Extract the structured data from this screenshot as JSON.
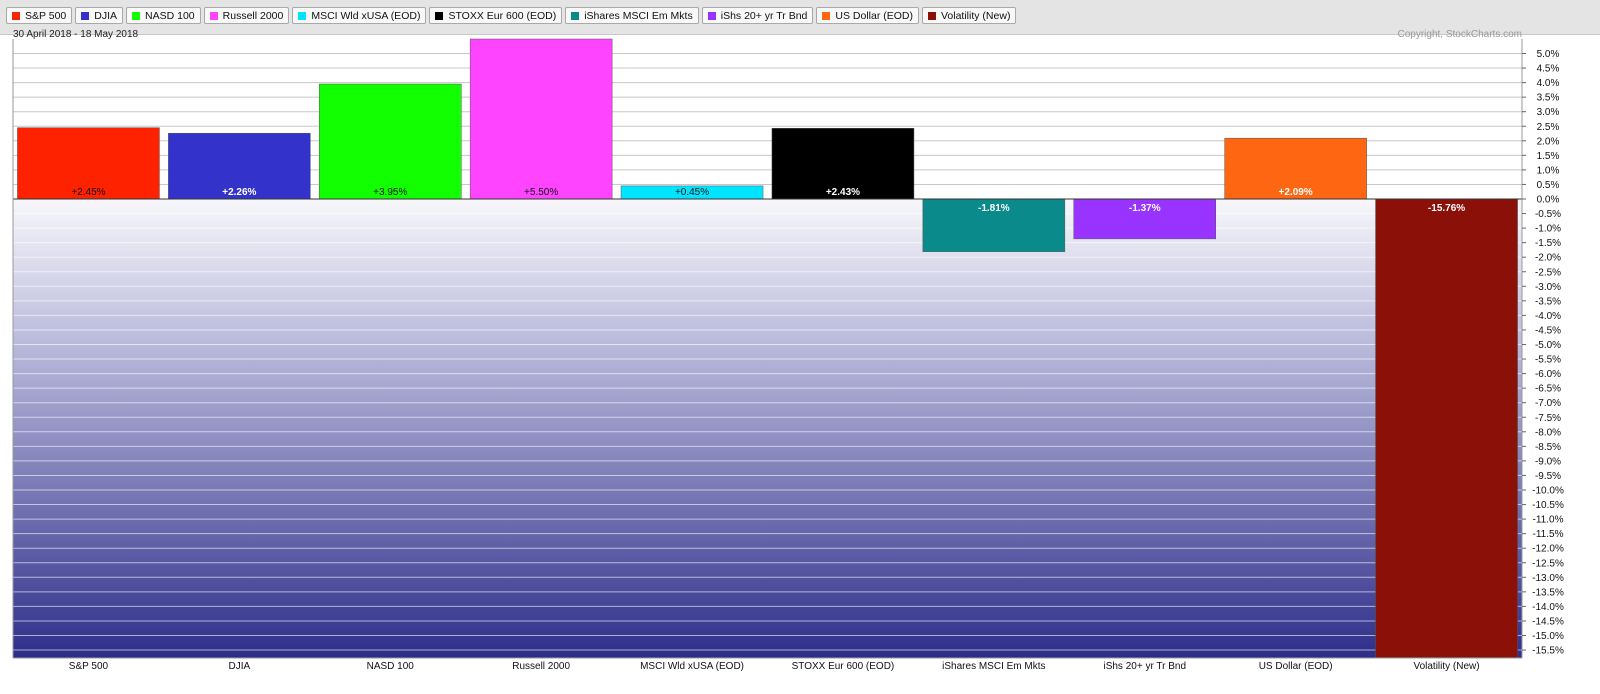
{
  "date_range": "30 April 2018 - 18 May 2018",
  "copyright": "Copyright, StockCharts.com",
  "legend": [
    {
      "label": "S&P 500",
      "color": "#ff2200"
    },
    {
      "label": "DJIA",
      "color": "#3333cc"
    },
    {
      "label": "NASD 100",
      "color": "#11ff00"
    },
    {
      "label": "Russell 2000",
      "color": "#ff44ff"
    },
    {
      "label": "MSCI Wld xUSA (EOD)",
      "color": "#00e5ff"
    },
    {
      "label": "STOXX Eur 600 (EOD)",
      "color": "#000000"
    },
    {
      "label": "iShares MSCI Em Mkts",
      "color": "#0a8a8a"
    },
    {
      "label": "iShs 20+ yr Tr Bnd",
      "color": "#9933ff"
    },
    {
      "label": "US Dollar (EOD)",
      "color": "#ff6611"
    },
    {
      "label": "Volatility (New)",
      "color": "#8b1108"
    }
  ],
  "chart_data": {
    "type": "bar",
    "categories": [
      "S&P 500",
      "DJIA",
      "NASD 100",
      "Russell 2000",
      "MSCI Wld xUSA (EOD)",
      "STOXX Eur 600 (EOD)",
      "iShares MSCI Em Mkts",
      "iShs 20+ yr Tr Bnd",
      "US Dollar (EOD)",
      "Volatility (New)"
    ],
    "values": [
      2.45,
      2.26,
      3.95,
      5.5,
      0.45,
      2.43,
      -1.81,
      -1.37,
      2.09,
      -15.76
    ],
    "data_labels": [
      "+2.45%",
      "+2.26%",
      "+3.95%",
      "+5.50%",
      "+0.45%",
      "+2.43%",
      "-1.81%",
      "-1.37%",
      "+2.09%",
      "-15.76%"
    ],
    "colors": [
      "#ff2200",
      "#3333cc",
      "#11ff00",
      "#ff44ff",
      "#00e5ff",
      "#000000",
      "#0a8a8a",
      "#9933ff",
      "#ff6611",
      "#8b1108"
    ],
    "label_colors": [
      "#111111",
      "#ffffff",
      "#111111",
      "#111111",
      "#111111",
      "#ffffff",
      "#ffffff",
      "#ffffff",
      "#ffffff",
      "#ffffff"
    ],
    "title": "",
    "xlabel": "",
    "ylabel": "",
    "ylim": [
      -15.76,
      5.5
    ],
    "yticks": [
      "5.0%",
      "4.5%",
      "4.0%",
      "3.5%",
      "3.0%",
      "2.5%",
      "2.0%",
      "1.5%",
      "1.0%",
      "0.5%",
      "0.0%",
      "-0.5%",
      "-1.0%",
      "-1.5%",
      "-2.0%",
      "-2.5%",
      "-3.0%",
      "-3.5%",
      "-4.0%",
      "-4.5%",
      "-5.0%",
      "-5.5%",
      "-6.0%",
      "-6.5%",
      "-7.0%",
      "-7.5%",
      "-8.0%",
      "-8.5%",
      "-9.0%",
      "-9.5%",
      "-10.0%",
      "-10.5%",
      "-11.0%",
      "-11.5%",
      "-12.0%",
      "-12.5%",
      "-13.0%",
      "-13.5%",
      "-14.0%",
      "-14.5%",
      "-15.0%",
      "-15.5%"
    ],
    "grid": true,
    "legend_position": "top-left"
  }
}
